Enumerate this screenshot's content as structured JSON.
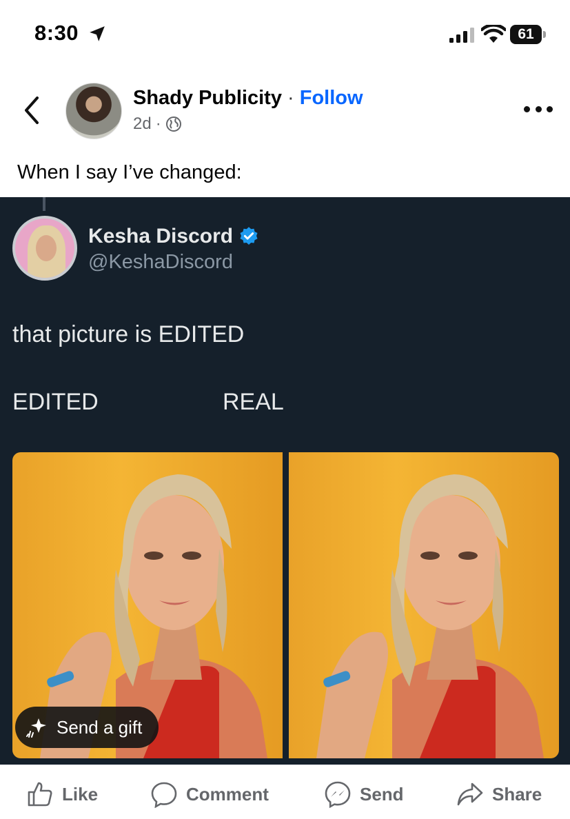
{
  "status_bar": {
    "time": "8:30",
    "battery": "61"
  },
  "post": {
    "page_name": "Shady Publicity",
    "separator": "·",
    "follow_label": "Follow",
    "age": "2d",
    "meta_separator": "·",
    "caption": "When I say I’ve changed:"
  },
  "embed": {
    "display_name": "Kesha Discord",
    "handle": "@KeshaDiscord",
    "text": "that picture is EDITED",
    "label_left": "EDITED",
    "label_right": "REAL",
    "gift_label": "Send a gift"
  },
  "actions": {
    "like": "Like",
    "comment": "Comment",
    "send": "Send",
    "share": "Share"
  },
  "colors": {
    "follow": "#0866ff",
    "embed_bg": "#15202b",
    "photo_bg": "#f4b534",
    "verified": "#1d9bf0"
  }
}
